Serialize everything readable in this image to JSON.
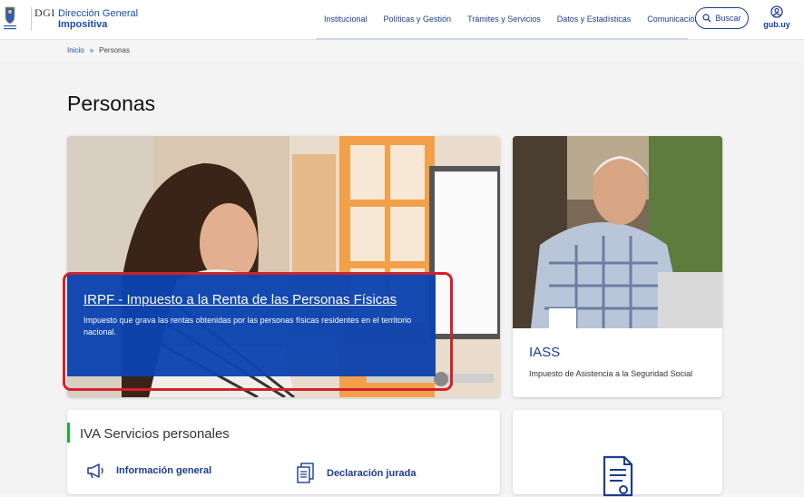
{
  "header": {
    "dgi_mark": "DGI",
    "brand_line1": "Dirección General",
    "brand_line2": "Impositiva",
    "nav": [
      "Institucional",
      "Políticas y Gestión",
      "Trámites y Servicios",
      "Datos y Estadísticas",
      "Comunicación"
    ],
    "search_label": "Buscar",
    "gub_label": "gub.uy",
    "accent": "#1a3d8f"
  },
  "breadcrumb": {
    "home": "Inicio",
    "separator": "»",
    "current": "Personas"
  },
  "page_title": "Personas",
  "cards": {
    "irpf": {
      "title": "IRPF - Impuesto a la Renta de las Personas Físicas",
      "description": "Impuesto que grava las rentas obtenidas por las personas físicas residentes en el territorio nacional.",
      "overlay_color": "#0b44b0"
    },
    "iass": {
      "title": "IASS",
      "description": "Impuesto de Asistencia a la Seguridad Social"
    },
    "iva": {
      "title": "IVA Servicios personales",
      "links": [
        "Información general",
        "Declaración jurada"
      ],
      "bar_color": "#1faa3c"
    }
  },
  "icons": [
    "search-icon",
    "user-circle-icon",
    "megaphone-icon",
    "documents-icon",
    "document-certificate-icon"
  ]
}
